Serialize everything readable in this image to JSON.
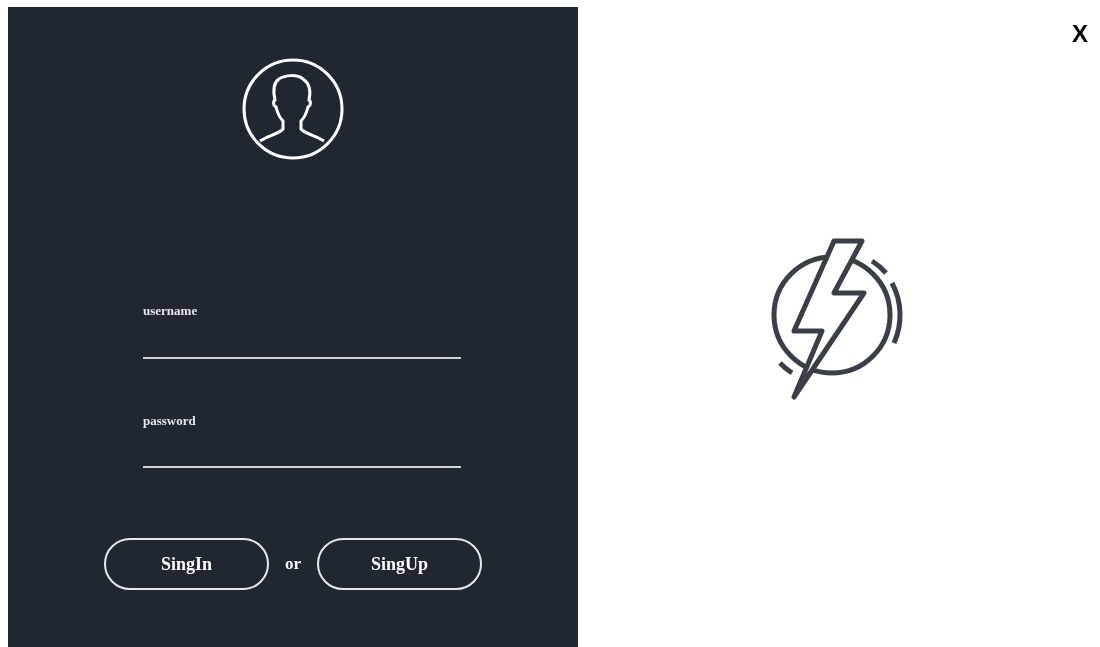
{
  "login_panel": {
    "fields": [
      {
        "label": "username"
      },
      {
        "label": "password"
      }
    ],
    "buttons": [
      {
        "label": "SingIn"
      },
      {
        "label": "SingUp"
      }
    ],
    "separator": "or"
  },
  "close_button": {
    "label": "X"
  }
}
